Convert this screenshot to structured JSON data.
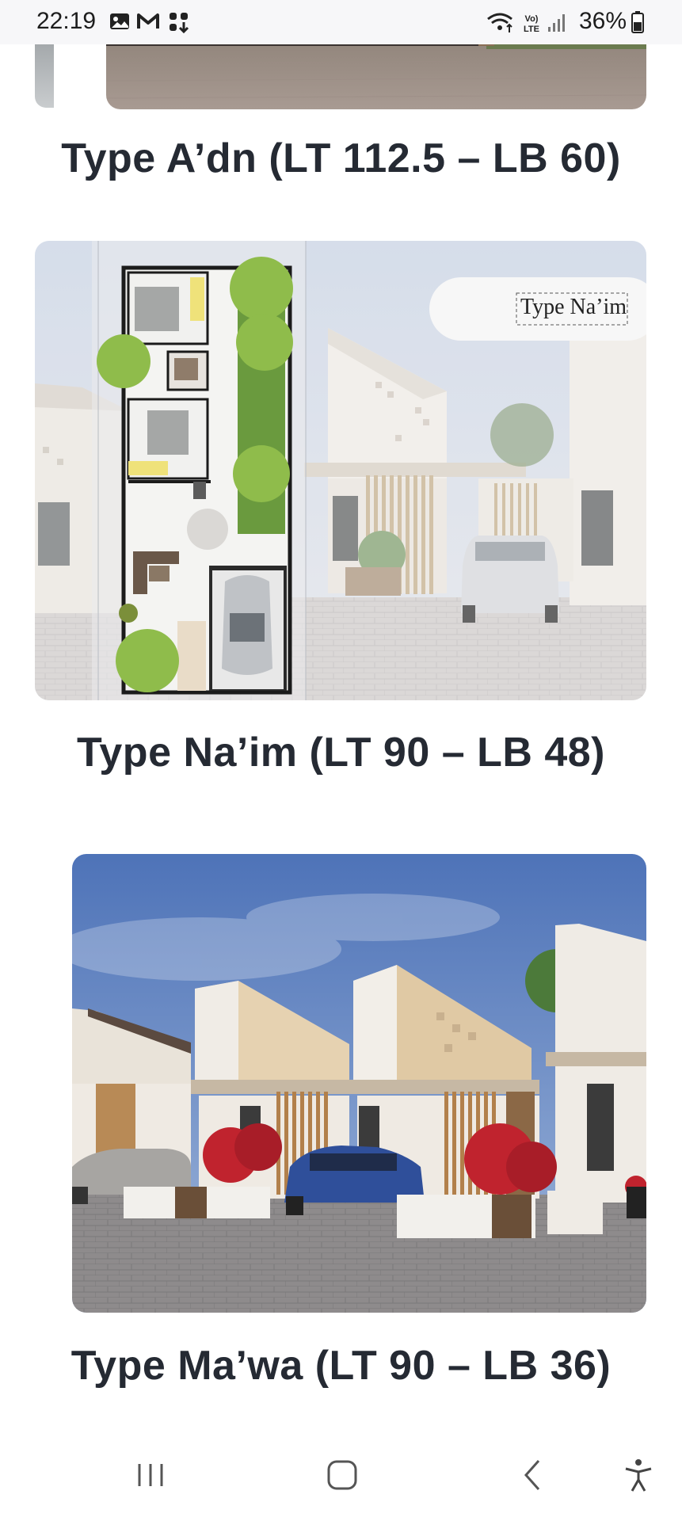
{
  "status_bar": {
    "time": "22:19",
    "battery": "36%",
    "icons": [
      "gallery-icon",
      "gmail-icon",
      "app-grid-icon",
      "wifi-icon",
      "volte-icon",
      "signal-icon",
      "battery-icon"
    ]
  },
  "cards": [
    {
      "title": "Type A’dn (LT 112.5 – LB 60)"
    },
    {
      "title": "Type Na’im (LT 90 – LB 48)",
      "image_label": "Type Na’im"
    },
    {
      "title": "Type Ma’wa (LT 90 – LB 36)"
    }
  ],
  "nav_bar": {
    "buttons": [
      "recent-apps-icon",
      "home-icon",
      "back-icon",
      "accessibility-icon"
    ]
  },
  "colors": {
    "text": "#252a33",
    "sky": "#5f86c4",
    "wall": "#e8e3da",
    "pavement": "#8e8d8e"
  }
}
